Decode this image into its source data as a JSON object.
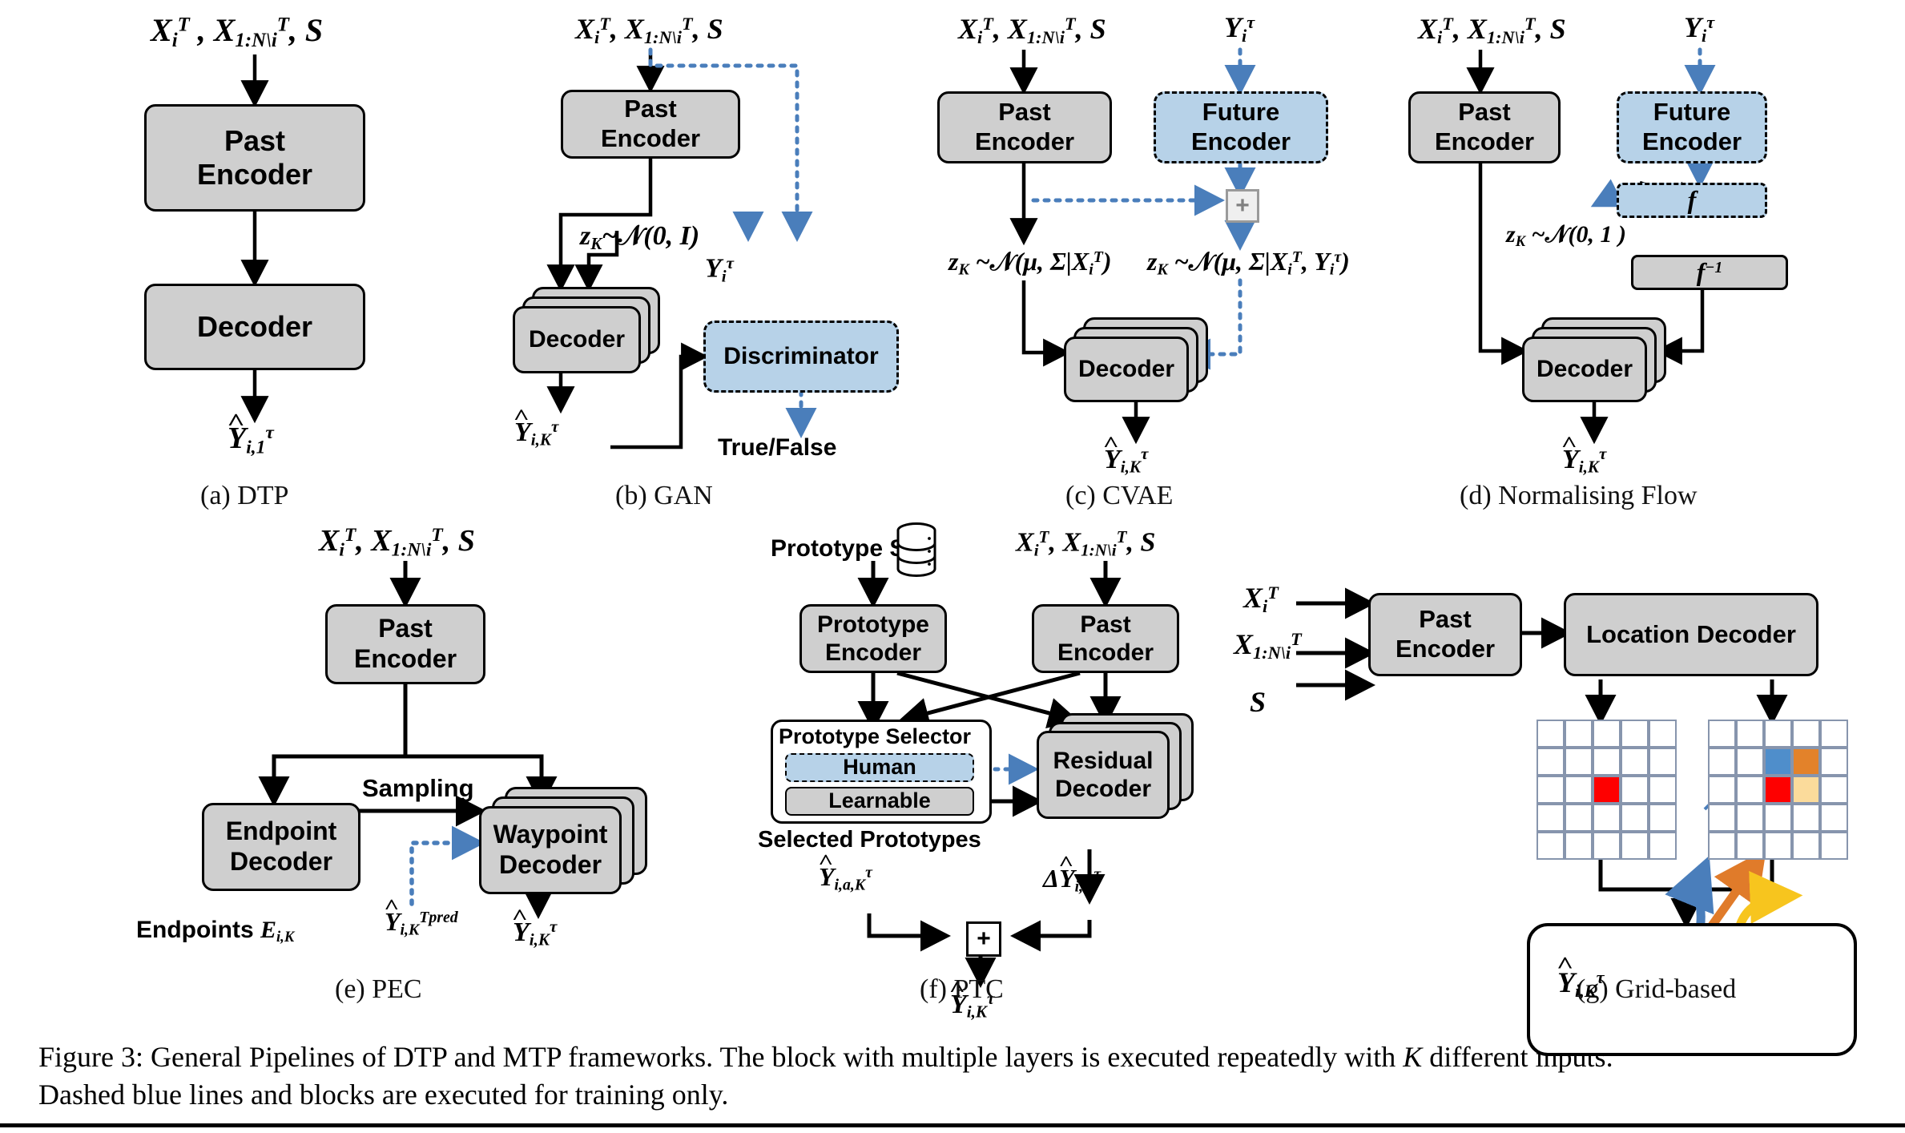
{
  "figure": {
    "caption_prefix": "Figure 3:",
    "caption_line1_a": " General Pipelines of DTP and MTP frameworks.  The block with multiple layers is executed repeatedly with ",
    "caption_k": "K",
    "caption_line1_b": " different inputs.",
    "caption_line2": "Dashed blue lines and blocks are executed for training only."
  },
  "colors": {
    "block_gray": "#cfcfcf",
    "block_blue": "#b7d2e8",
    "dashed_blue_line": "#4a7ebb",
    "outline": "#000000",
    "grid_line": "#8795ad",
    "cell_red": "#fe0000",
    "cell_blue": "#4f8ecb",
    "cell_orange": "#e3822a",
    "cell_yellow": "#fbdb9b",
    "traj_red": "#e8191b",
    "traj_blue": "#4a7ebb",
    "traj_orange": "#e07b2a",
    "traj_yellow": "#f7c51e"
  },
  "common": {
    "past_encoder": "Past\nEncoder",
    "future_encoder": "Future\nEncoder",
    "decoder": "Decoder"
  },
  "panels": [
    {
      "id": "a",
      "caption": "(a) DTP",
      "input_label": "X_i^T , X_{1:N\\i}^T, S",
      "blocks": [
        "Past\nEncoder",
        "Decoder"
      ],
      "output_label": "Ŷ_{i,1}^τ"
    },
    {
      "id": "b",
      "caption": "(b) GAN",
      "input_label": "X_i^T, X_{1:N\\i}^T, S",
      "blocks": [
        "Past\nEncoder",
        "Decoder",
        "Discriminator"
      ],
      "noise_label": "z_K ~ N(0, I)",
      "gt_label": "Y_i^τ",
      "output_label": "Ŷ_{i,K}^τ",
      "discriminator_output": "True/False"
    },
    {
      "id": "c",
      "caption": "(c) CVAE",
      "input_label": "X_i^T, X_{1:N\\i}^T, S",
      "gt_label": "Y_i^τ",
      "blocks": [
        "Past\nEncoder",
        "Future\nEncoder",
        "Decoder"
      ],
      "latent_prior": "z_K ~ N(μ, Σ|X_i^T)",
      "latent_post": "z_K ~ N(μ, Σ|X_i^T, Y_i^τ)",
      "merge_symbol": "+",
      "output_label": "Ŷ_{i,K}^τ"
    },
    {
      "id": "d",
      "caption": "(d) Normalising Flow",
      "input_label": "X_i^T, X_{1:N\\i}^T, S",
      "gt_label": "Y_i^τ",
      "blocks": [
        "Past\nEncoder",
        "Future\nEncoder",
        "f",
        "f⁻¹",
        "Decoder"
      ],
      "flow_forward": "f",
      "flow_inverse": "f⁻¹",
      "latent_label": "z_K ~ N(0, 1 )",
      "output_label": "Ŷ_{i,K}^τ"
    },
    {
      "id": "e",
      "caption": "(e) PEC",
      "input_label": "X_i^T, X_{1:N\\i}^T, S",
      "blocks": [
        "Past\nEncoder",
        "Endpoint\nDecoder",
        "Waypoint\nDecoder"
      ],
      "sampling_label": "Sampling",
      "endpoints_label": "Endpoints E_{i,K}",
      "pred_label": "Ŷ_{i,K}^{T_pred}",
      "output_label": "Ŷ_{i,K}^τ"
    },
    {
      "id": "f",
      "caption": "(f) PTC",
      "prototype_set_label": "Prototype Set",
      "prototype_set_icon": "database-icon",
      "input_label": "X_i^T, X_{1:N\\i}^T, S",
      "blocks": [
        "Prototype\nEncoder",
        "Past\nEncoder",
        "Residual\nDecoder"
      ],
      "selector_title": "Prototype Selector",
      "selector_options": [
        "Human",
        "Learnable"
      ],
      "selected_prototypes_label": "Selected Prototypes",
      "selected_prototypes_sym": "Ŷ_{i,a,K}^τ",
      "residual_sym": "ΔŶ_{i,K}^τ",
      "merge_symbol": "+",
      "output_label": "Ŷ_{i,K}^τ"
    },
    {
      "id": "g",
      "caption": "(g) Grid-based",
      "inputs": [
        "X_i^T",
        "X_{1:N\\i}^T",
        "S"
      ],
      "blocks": [
        "Past\nEncoder",
        "Location Decoder"
      ],
      "grid_left": {
        "rows": 5,
        "cols": 5,
        "highlight": {
          "row": 3,
          "col": 3,
          "color": "#fe0000"
        }
      },
      "grid_right": {
        "rows": 5,
        "cols": 5,
        "cells": [
          {
            "row": 2,
            "col": 3,
            "color": "#4f8ecb",
            "arrow": "up"
          },
          {
            "row": 2,
            "col": 4,
            "color": "#e3822a",
            "arrow": "up-right"
          },
          {
            "row": 3,
            "col": 3,
            "color": "#fe0000",
            "arrow": "up-right-blue"
          },
          {
            "row": 3,
            "col": 4,
            "color": "#fbdb9b",
            "arrow": "right"
          }
        ]
      },
      "output_label": "Ŷ_{i,K}^τ"
    }
  ]
}
